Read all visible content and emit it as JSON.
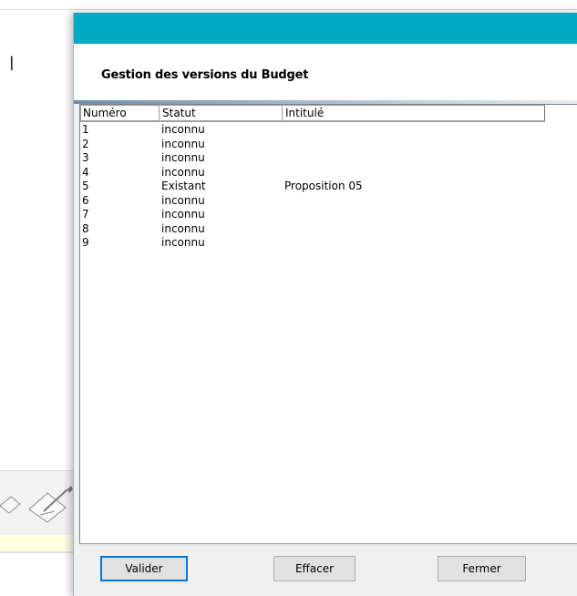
{
  "background": {
    "letter": "l"
  },
  "dialog": {
    "title": "Gestion des versions du Budget",
    "columns": [
      "Numéro",
      "Statut",
      "Intitulé"
    ],
    "rows": [
      {
        "numero": "1",
        "statut": "inconnu",
        "intitule": ""
      },
      {
        "numero": "2",
        "statut": "inconnu",
        "intitule": ""
      },
      {
        "numero": "3",
        "statut": "inconnu",
        "intitule": ""
      },
      {
        "numero": "4",
        "statut": "inconnu",
        "intitule": ""
      },
      {
        "numero": "5",
        "statut": "Existant",
        "intitule": "Proposition 05"
      },
      {
        "numero": "6",
        "statut": "inconnu",
        "intitule": ""
      },
      {
        "numero": "7",
        "statut": "inconnu",
        "intitule": ""
      },
      {
        "numero": "8",
        "statut": "inconnu",
        "intitule": ""
      },
      {
        "numero": "9",
        "statut": "inconnu",
        "intitule": ""
      }
    ],
    "buttons": {
      "valider": "Valider",
      "effacer": "Effacer",
      "fermer": "Fermer"
    }
  },
  "colors": {
    "titlebar": "#00aac4",
    "primary_border": "#0078d7"
  }
}
